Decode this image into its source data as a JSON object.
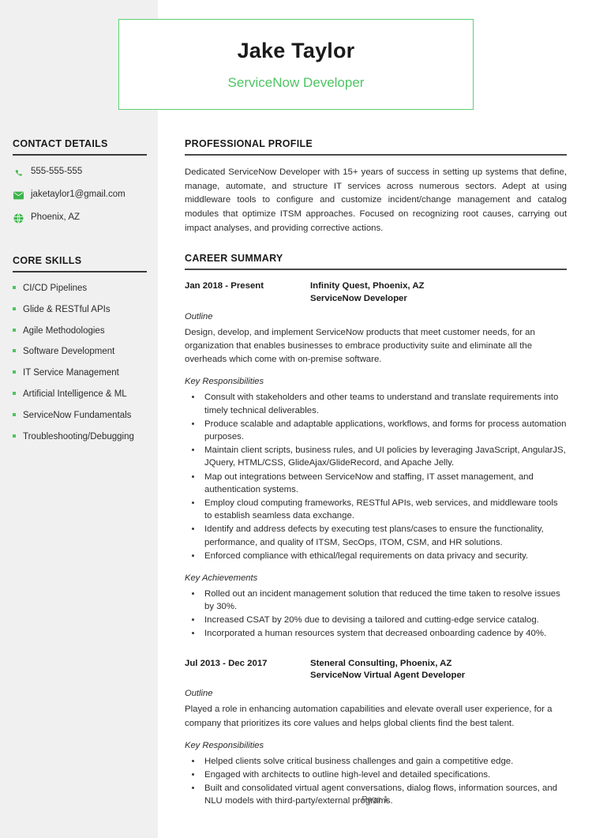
{
  "header": {
    "name": "Jake Taylor",
    "job_title": "ServiceNow Developer",
    "border_color": "#5ece6f",
    "accent_color": "#4ec463"
  },
  "sidebar": {
    "contact": {
      "title": "CONTACT DETAILS",
      "items": [
        {
          "icon": "phone-icon",
          "value": "555-555-555"
        },
        {
          "icon": "envelope-icon",
          "value": "jaketaylor1@gmail.com"
        },
        {
          "icon": "globe-icon",
          "value": "Phoenix, AZ"
        }
      ]
    },
    "skills": {
      "title": "CORE SKILLS",
      "items": [
        "CI/CD Pipelines",
        "Glide & RESTful APIs",
        "Agile Methodologies",
        "Software Development",
        "IT Service Management",
        "Artificial Intelligence & ML",
        "ServiceNow Fundamentals",
        "Troubleshooting/Debugging"
      ]
    }
  },
  "main": {
    "profile": {
      "title": "PROFESSIONAL PROFILE",
      "text": "Dedicated ServiceNow Developer with 15+ years of success in setting up systems that define, manage, automate, and structure IT services across numerous sectors. Adept at using middleware tools to configure and customize incident/change management and catalog modules that optimize ITSM approaches. Focused on recognizing root causes, carrying out impact analyses, and providing corrective actions."
    },
    "career": {
      "title": "CAREER SUMMARY",
      "jobs": [
        {
          "dates": "Jan 2018 - Present",
          "company": "Infinity Quest, Phoenix, AZ",
          "role": "ServiceNow Developer",
          "outline_label": "Outline",
          "outline": "Design, develop, and implement ServiceNow products that meet customer needs, for an organization that enables businesses to embrace productivity suite and eliminate all the overheads which come with on-premise software.",
          "responsibilities_label": "Key Responsibilities",
          "responsibilities": [
            "Consult with stakeholders and other teams to understand and translate requirements into timely technical deliverables.",
            "Produce scalable and adaptable applications, workflows, and forms for process automation purposes.",
            "Maintain client scripts, business rules, and UI policies by leveraging JavaScript, AngularJS, JQuery, HTML/CSS, GlideAjax/GlideRecord, and Apache Jelly.",
            "Map out integrations between ServiceNow and staffing, IT asset management, and authentication systems.",
            "Employ cloud computing frameworks, RESTful APIs, web services, and middleware tools to establish seamless data exchange.",
            "Identify and address defects by executing test plans/cases to ensure the functionality, performance, and quality of ITSM, SecOps, ITOM, CSM, and HR solutions.",
            "Enforced compliance with ethical/legal requirements on data privacy and security."
          ],
          "achievements_label": "Key Achievements",
          "achievements": [
            "Rolled out an incident management solution that reduced the time taken to resolve issues by 30%.",
            "Increased CSAT by 20% due to devising a tailored and cutting-edge service catalog.",
            "Incorporated a human resources system that decreased onboarding cadence by 40%."
          ]
        },
        {
          "dates": "Jul 2013 - Dec 2017",
          "company": "Steneral Consulting, Phoenix, AZ",
          "role": "ServiceNow Virtual Agent Developer",
          "outline_label": "Outline",
          "outline": "Played a role in enhancing automation capabilities and elevate overall user experience, for a company that prioritizes its core values and helps global clients find the best talent.",
          "responsibilities_label": "Key Responsibilities",
          "responsibilities": [
            "Helped clients solve critical business challenges and gain a competitive edge.",
            "Engaged with architects to outline high-level and detailed specifications.",
            "Built and consolidated virtual agent conversations, dialog flows, information sources, and NLU models with third-party/external programs."
          ],
          "achievements_label": "",
          "achievements": []
        }
      ]
    }
  },
  "footer": {
    "page_label": "Page 1"
  }
}
